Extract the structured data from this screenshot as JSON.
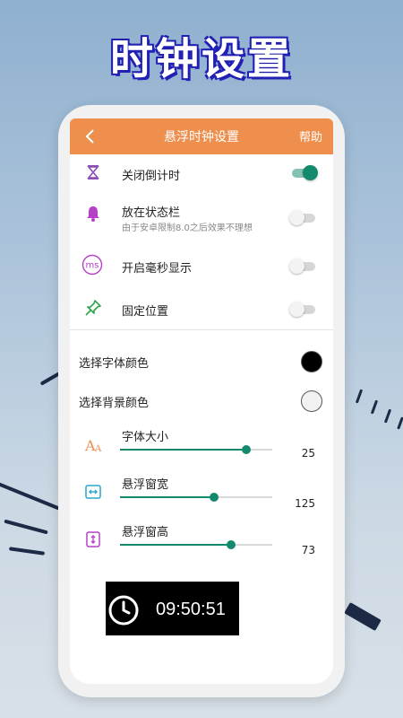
{
  "promo": {
    "title": "时钟设置"
  },
  "topbar": {
    "title": "悬浮时钟设置",
    "help": "帮助"
  },
  "toggles": [
    {
      "label": "关闭倒计时",
      "sub": "",
      "on": true,
      "icon": "hourglass-icon"
    },
    {
      "label": "放在状态栏",
      "sub": "由于安卓限制8.0之后效果不理想",
      "on": false,
      "icon": "bell-icon"
    },
    {
      "label": "开启毫秒显示",
      "sub": "",
      "on": false,
      "icon": "ms-icon",
      "icon_text": "ms"
    },
    {
      "label": "固定位置",
      "sub": "",
      "on": false,
      "icon": "pin-icon"
    }
  ],
  "colors": [
    {
      "label": "选择字体颜色",
      "color": "#000000"
    },
    {
      "label": "选择背景颜色",
      "color": "#f2f2f2"
    }
  ],
  "sliders": [
    {
      "label": "字体大小",
      "value": "25",
      "fraction": 0.83,
      "icon": "font-size-icon"
    },
    {
      "label": "悬浮窗宽",
      "value": "125",
      "fraction": 0.62,
      "icon": "width-icon"
    },
    {
      "label": "悬浮窗高",
      "value": "73",
      "fraction": 0.73,
      "icon": "height-icon"
    }
  ],
  "preview": {
    "time": "09:50:51"
  },
  "colors_theme": {
    "accent": "#ee8f4e",
    "switch_on": "#138a6e"
  }
}
